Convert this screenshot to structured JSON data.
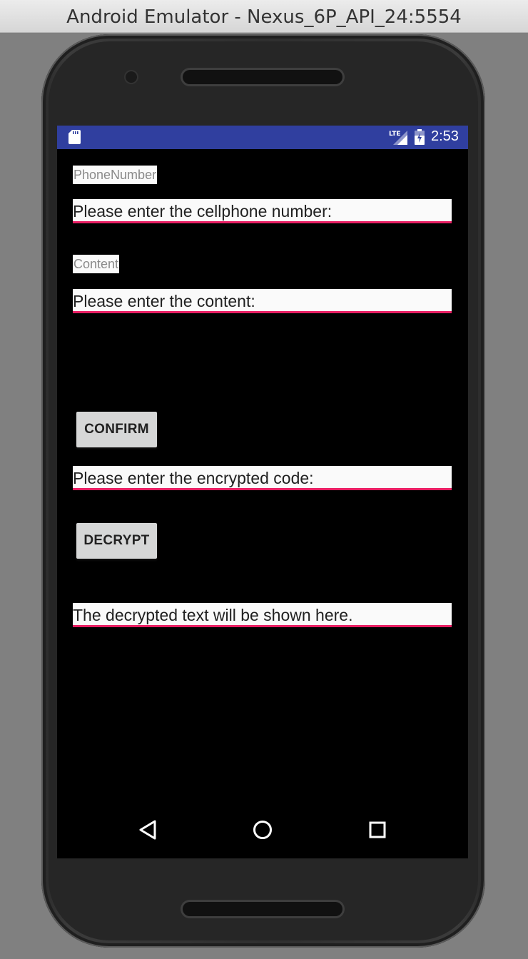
{
  "window": {
    "title": "Android Emulator - Nexus_6P_API_24:5554"
  },
  "status_bar": {
    "color": "#303f9f",
    "time": "2:53",
    "network_badge": "LTE",
    "icons": [
      "sd-card-icon",
      "lte-signal-icon",
      "battery-charging-icon"
    ]
  },
  "form": {
    "phone_label": "PhoneNumber",
    "phone_hint": "Please enter the cellphone number:",
    "content_label": "Content",
    "content_hint": "Please enter the content:",
    "confirm_button": "CONFIRM",
    "encrypted_hint": "Please enter the encrypted code:",
    "decrypt_button": "DECRYPT",
    "decrypted_output": "The decrypted text will be shown here.",
    "accent_color": "#e91e63"
  },
  "nav_bar": {
    "icons": [
      "back-icon",
      "home-icon",
      "recents-icon"
    ]
  }
}
